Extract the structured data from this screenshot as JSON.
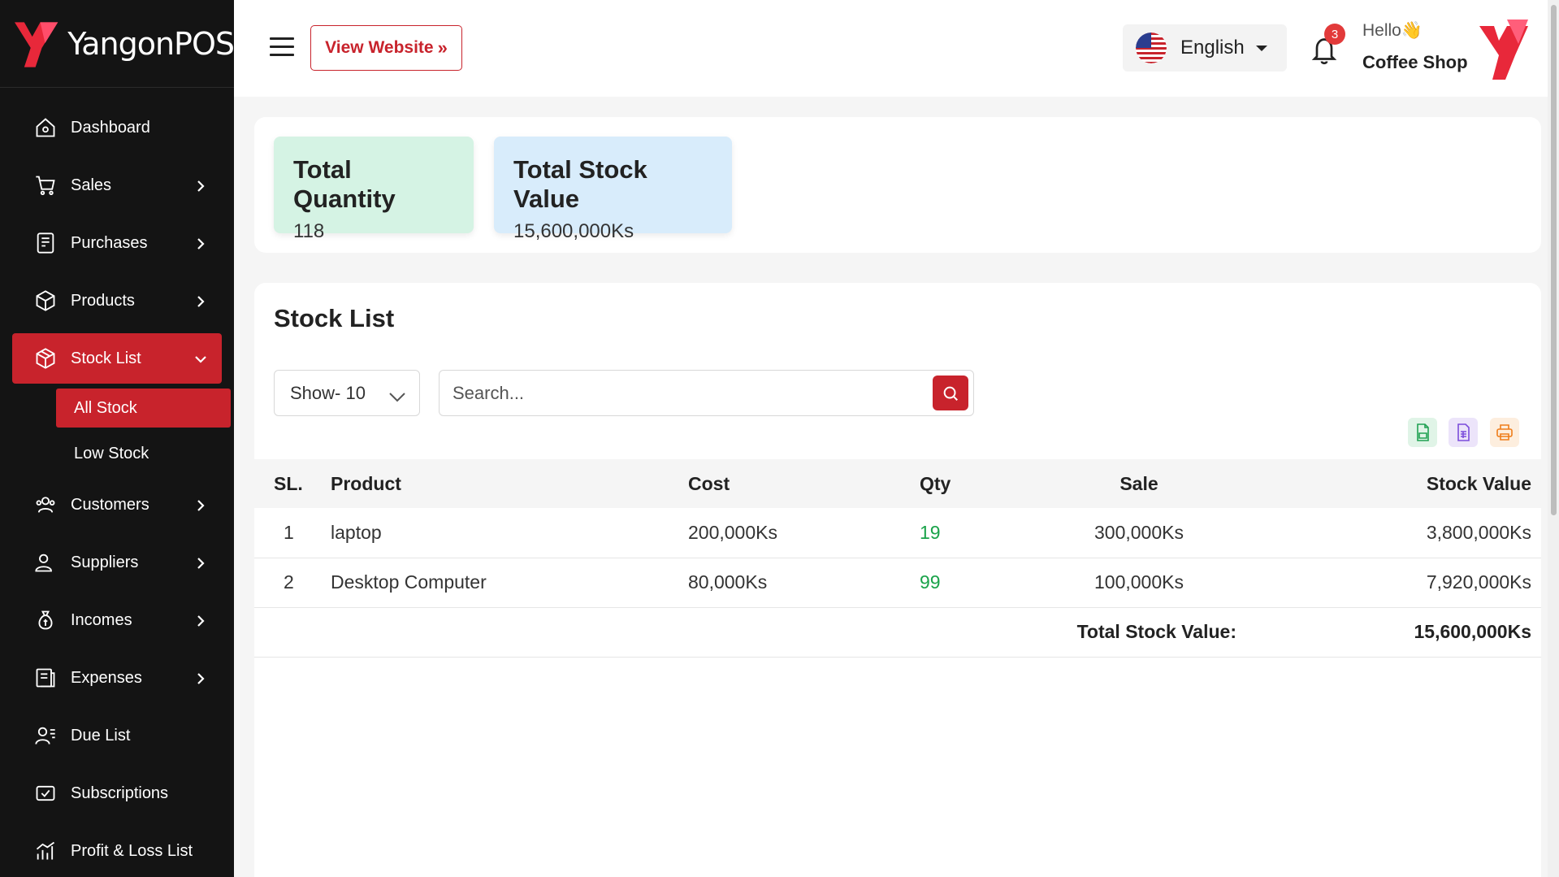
{
  "brand": {
    "name": "YangonPOS",
    "accent": "#c8232c",
    "logo_icon": "brand-y-logo"
  },
  "sidebar": {
    "items": [
      {
        "label": "Dashboard",
        "icon": "home-icon",
        "has_children": false
      },
      {
        "label": "Sales",
        "icon": "cart-icon",
        "has_children": true
      },
      {
        "label": "Purchases",
        "icon": "receipt-icon",
        "has_children": true
      },
      {
        "label": "Products",
        "icon": "box-icon",
        "has_children": true
      },
      {
        "label": "Stock List",
        "icon": "package-icon",
        "has_children": true,
        "expanded": true,
        "active": true
      },
      {
        "label": "Customers",
        "icon": "users-icon",
        "has_children": true
      },
      {
        "label": "Suppliers",
        "icon": "supplier-icon",
        "has_children": true
      },
      {
        "label": "Incomes",
        "icon": "money-bag-icon",
        "has_children": true
      },
      {
        "label": "Expenses",
        "icon": "expense-icon",
        "has_children": true
      },
      {
        "label": "Due List",
        "icon": "due-user-icon",
        "has_children": false
      },
      {
        "label": "Subscriptions",
        "icon": "subscription-icon",
        "has_children": false
      },
      {
        "label": "Profit & Loss List",
        "icon": "chart-icon",
        "has_children": false
      }
    ],
    "stock_sub": [
      {
        "label": "All Stock",
        "active": true
      },
      {
        "label": "Low Stock",
        "active": false
      }
    ]
  },
  "header": {
    "view_website": "View Website",
    "language": "English",
    "notification_count": "3",
    "greeting": "Hello👋",
    "shop_name": "Coffee Shop"
  },
  "summary": {
    "total_quantity_label": "Total Quantity",
    "total_quantity": "118",
    "total_value_label": "Total Stock Value",
    "total_value": "15,600,000Ks"
  },
  "stock_list": {
    "title": "Stock List",
    "show_value": "Show- 10",
    "search_placeholder": "Search...",
    "columns": [
      "SL.",
      "Product",
      "Cost",
      "Qty",
      "Sale",
      "Stock Value"
    ],
    "rows": [
      {
        "sl": "1",
        "product": "laptop",
        "cost": "200,000Ks",
        "qty": "19",
        "sale": "300,000Ks",
        "value": "3,800,000Ks"
      },
      {
        "sl": "2",
        "product": "Desktop Computer",
        "cost": "80,000Ks",
        "qty": "99",
        "sale": "100,000Ks",
        "value": "7,920,000Ks"
      }
    ],
    "total_label": "Total Stock Value:",
    "total_value": "15,600,000Ks"
  }
}
